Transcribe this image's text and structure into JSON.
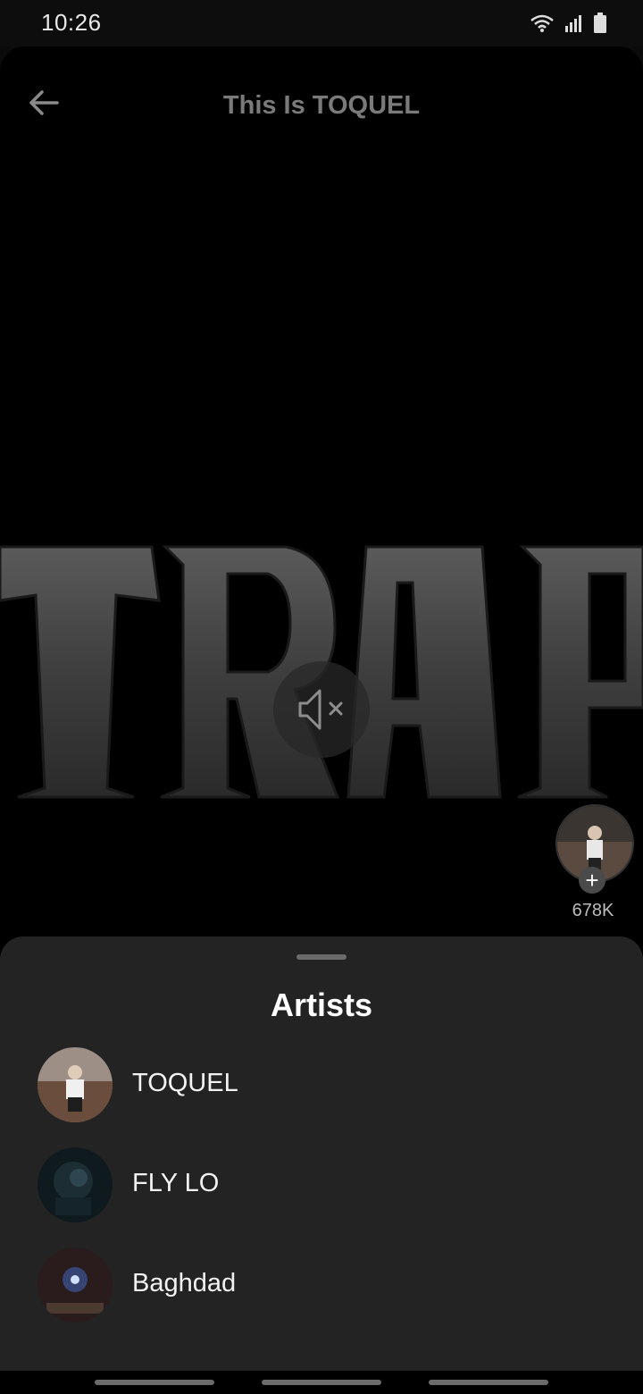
{
  "status": {
    "time": "10:26",
    "icons": [
      "wifi-icon",
      "signal-icon",
      "battery-icon"
    ]
  },
  "header": {
    "title": "This Is TOQUEL",
    "back_icon": "arrow-left-icon"
  },
  "video": {
    "mute_icon": "speaker-muted-icon",
    "like_count": "678K",
    "follow_icon": "plus-icon"
  },
  "sheet": {
    "title": "Artists",
    "artists": [
      {
        "name": "TOQUEL"
      },
      {
        "name": "FLY LO"
      },
      {
        "name": "Baghdad"
      }
    ]
  },
  "colors": {
    "background": "#000000",
    "sheet": "#232323",
    "title_dim": "#7a7a7a"
  }
}
